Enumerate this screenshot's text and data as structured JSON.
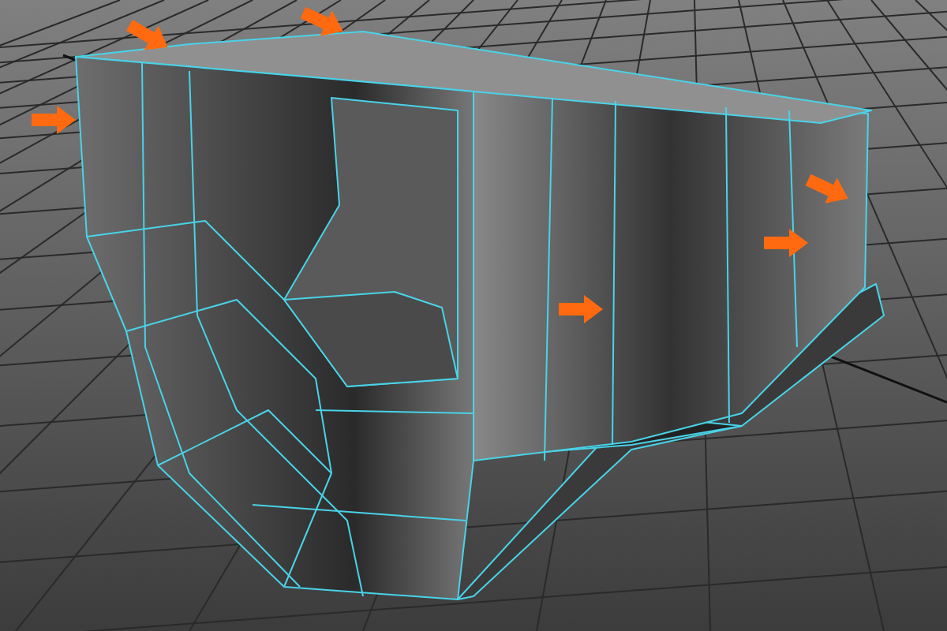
{
  "viewport": {
    "grid_visible": true,
    "wireframe_on_shaded": true,
    "annotation_arrows": true
  }
}
